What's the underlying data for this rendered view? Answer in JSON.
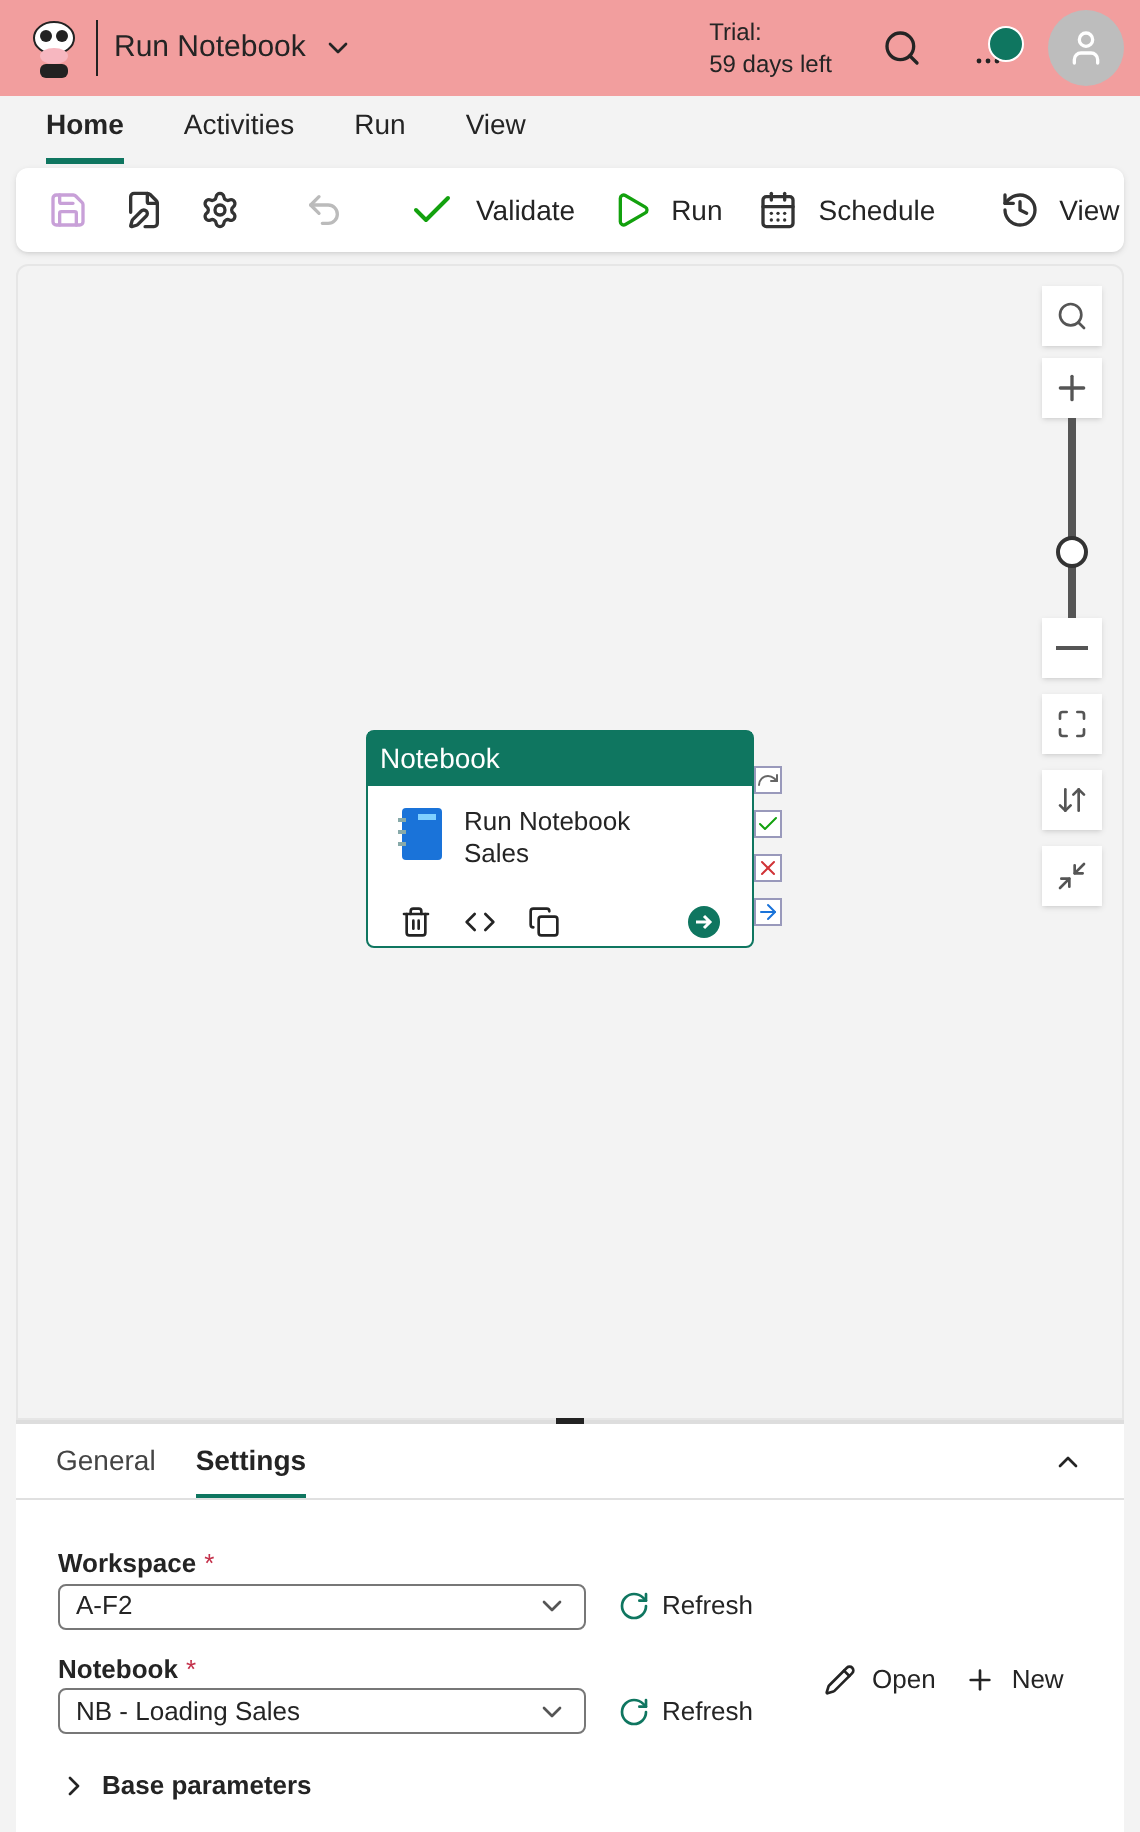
{
  "header": {
    "title": "Run Notebook",
    "trial_label": "Trial:",
    "trial_days": "59 days left"
  },
  "ribbon_tabs": [
    {
      "label": "Home",
      "selected": true
    },
    {
      "label": "Activities",
      "selected": false
    },
    {
      "label": "Run",
      "selected": false
    },
    {
      "label": "View",
      "selected": false
    }
  ],
  "toolbar": [
    {
      "kind": "save",
      "disabled": true
    },
    {
      "kind": "save-edit",
      "disabled": false
    },
    {
      "kind": "settings",
      "disabled": false
    },
    {
      "kind": "divider"
    },
    {
      "kind": "undo",
      "disabled": true
    },
    {
      "kind": "divider"
    },
    {
      "kind": "validate",
      "label": "Validate"
    },
    {
      "kind": "run",
      "label": "Run"
    },
    {
      "kind": "schedule",
      "label": "Schedule"
    },
    {
      "kind": "divider"
    },
    {
      "kind": "history",
      "label": "View"
    }
  ],
  "zoom": {
    "level": 0.33
  },
  "activity": {
    "type": "Notebook",
    "name": "Run Notebook Sales"
  },
  "panel_tabs": [
    {
      "label": "General",
      "selected": false
    },
    {
      "label": "Settings",
      "selected": true
    }
  ],
  "settings": {
    "workspace": {
      "label": "Workspace",
      "value": "A-F2",
      "refresh": "Refresh"
    },
    "notebook": {
      "label": "Notebook",
      "value": "NB - Loading Sales",
      "refresh": "Refresh",
      "open": "Open",
      "new": "New"
    },
    "required_mark": "*",
    "base_parameters": "Base parameters",
    "base_parameters_expanded": false
  }
}
